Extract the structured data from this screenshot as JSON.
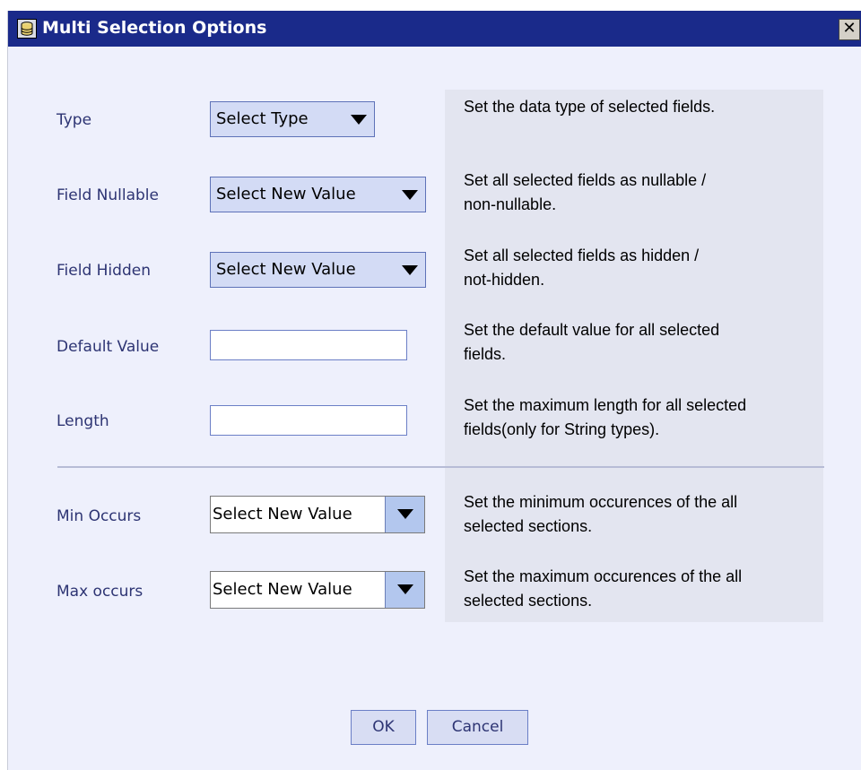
{
  "window": {
    "title": "Multi Selection Options",
    "close_glyph": "✕"
  },
  "fields": {
    "type": {
      "label": "Type",
      "value": "Select Type",
      "description": "Set the data type of selected fields."
    },
    "nullable": {
      "label": "Field Nullable",
      "value": "Select New Value",
      "description_1": "Set all selected fields as nullable /",
      "description_2": "non-nullable."
    },
    "hidden": {
      "label": "Field Hidden",
      "value": "Select New Value",
      "description_1": "Set all selected fields as hidden /",
      "description_2": "not-hidden."
    },
    "default_value": {
      "label": "Default Value",
      "value": "",
      "description_1": "Set the default value for all selected",
      "description_2": "fields."
    },
    "length": {
      "label": "Length",
      "value": "",
      "description_1": "Set the maximum length for all selected",
      "description_2": "fields(only for String types)."
    },
    "min_occurs": {
      "label": "Min Occurs",
      "value": "Select New Value",
      "description_1": "Set the minimum occurences of the all",
      "description_2": "selected sections."
    },
    "max_occurs": {
      "label": "Max occurs",
      "value": "Select New Value",
      "description_1": "Set the maximum occurences of the all",
      "description_2": "selected sections."
    }
  },
  "buttons": {
    "ok": "OK",
    "cancel": "Cancel"
  },
  "colors": {
    "titlebar": "#1a2a8a",
    "dialog_bg": "#eef0fc",
    "panel_bg": "#e3e5f0",
    "label": "#2d3473"
  }
}
